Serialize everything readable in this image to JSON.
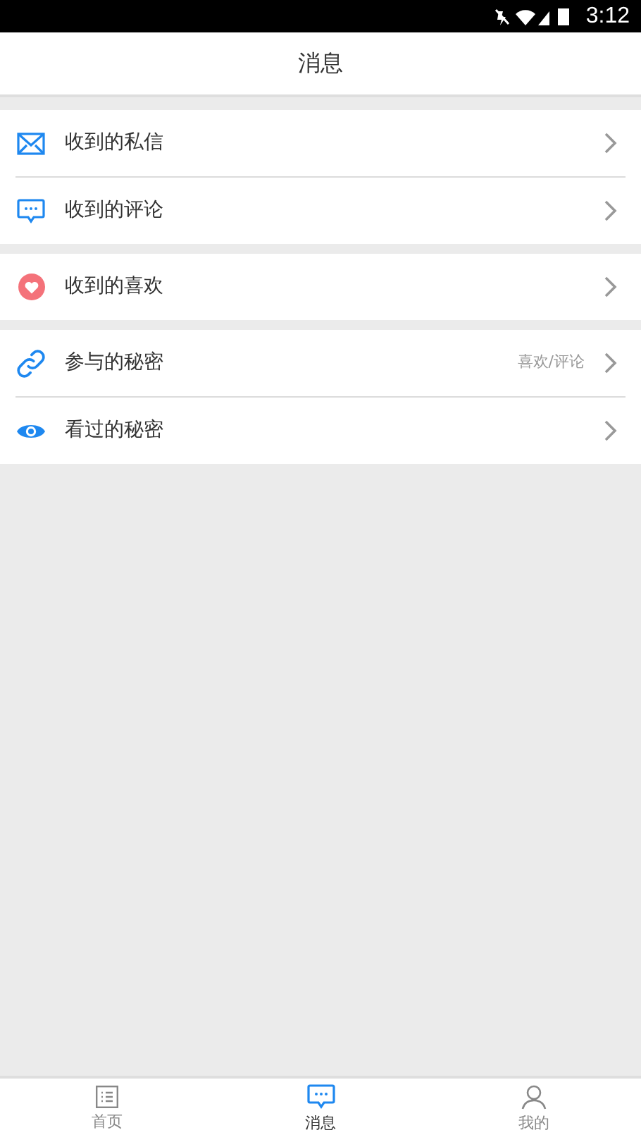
{
  "status_bar": {
    "time": "3:12"
  },
  "header": {
    "title": "消息"
  },
  "groups": [
    {
      "items": [
        {
          "label": "收到的私信"
        },
        {
          "label": "收到的评论"
        }
      ]
    },
    {
      "items": [
        {
          "label": "收到的喜欢"
        }
      ]
    },
    {
      "items": [
        {
          "label": "参与的秘密",
          "note": "喜欢/评论"
        },
        {
          "label": "看过的秘密"
        }
      ]
    }
  ],
  "tabs": [
    {
      "label": "首页",
      "selected": false
    },
    {
      "label": "消息",
      "selected": true
    },
    {
      "label": "我的",
      "selected": false
    }
  ]
}
